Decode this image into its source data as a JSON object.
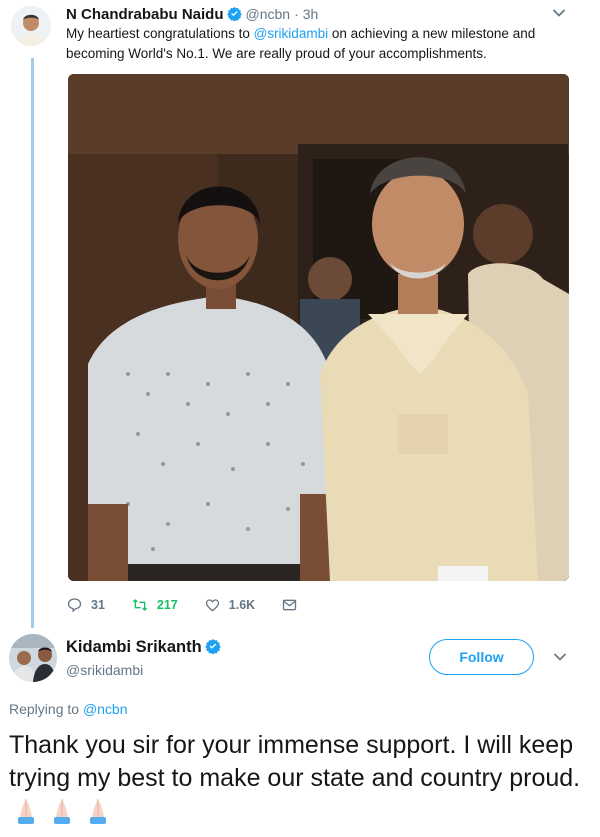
{
  "tweet1": {
    "author_name": "N Chandrababu Naidu",
    "handle": "@ncbn",
    "separator": "·",
    "time": "3h",
    "text_before": "My heartiest congratulations to ",
    "mention": "@srikidambi",
    "text_after": " on achieving a new milestone and becoming World's No.1. We are really proud of your accomplishments.",
    "replies": "31",
    "retweets": "217",
    "likes": "1.6K"
  },
  "tweet2": {
    "author_name": "Kidambi Srikanth",
    "handle": "@srikidambi",
    "follow_label": "Follow",
    "replying_prefix": "Replying to ",
    "replying_to": "@ncbn",
    "text": "Thank you sir for your immense support. I will keep trying my best to make our state and country proud.",
    "emoji_count": 3
  },
  "colors": {
    "accent": "#1da1f2",
    "retweet": "#17bf63",
    "muted": "#657786",
    "thread_line": "#9fcde8"
  },
  "icons": [
    "verified-badge-icon",
    "chevron-down-icon",
    "reply-icon",
    "retweet-icon",
    "like-icon",
    "direct-message-icon",
    "folded-hands-emoji"
  ]
}
